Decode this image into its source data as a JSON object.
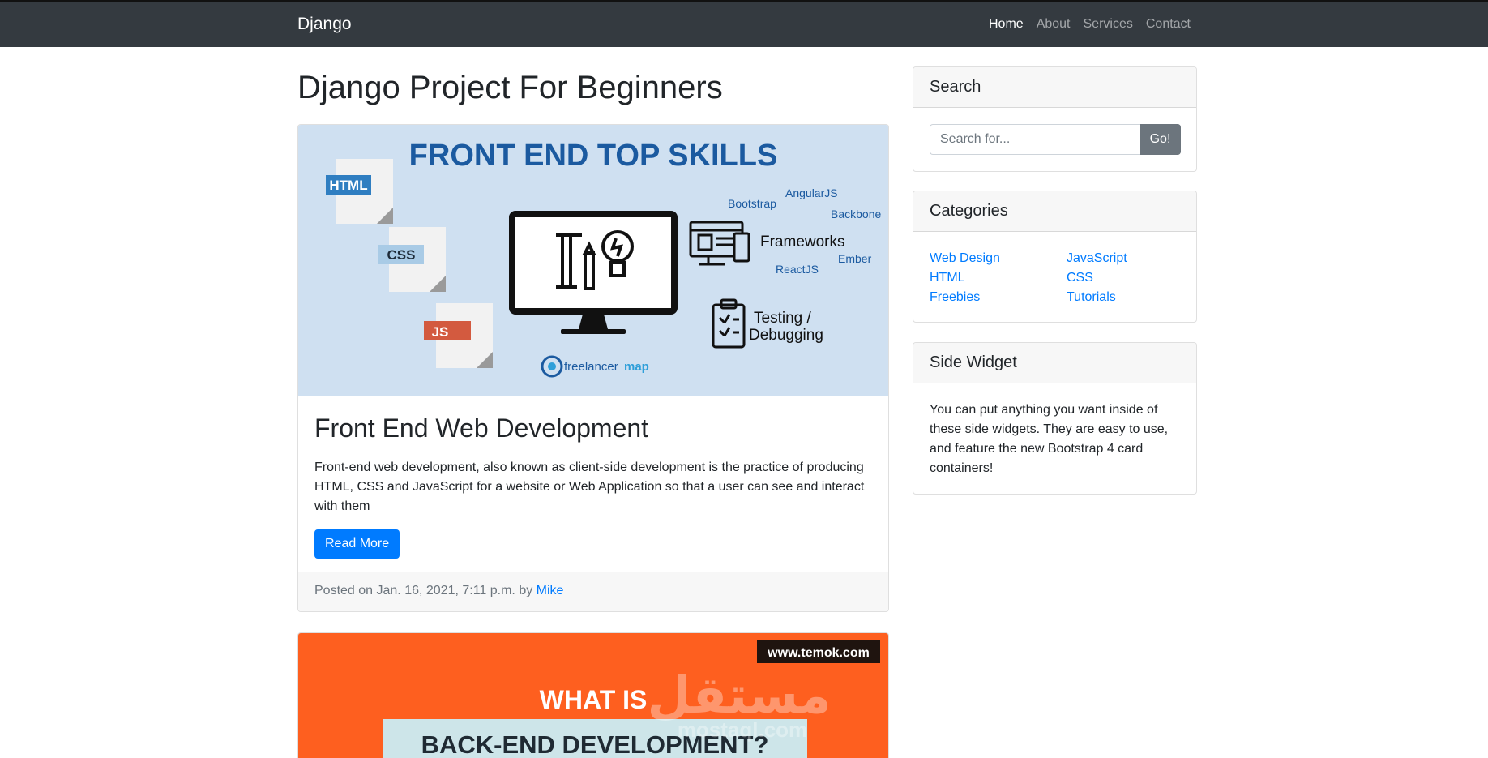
{
  "navbar": {
    "brand": "Django",
    "links": [
      "Home",
      "About",
      "Services",
      "Contact"
    ],
    "active_index": 0
  },
  "page_title": "Django Project For Beginners",
  "posts": [
    {
      "image": {
        "headline": "FRONT END TOP SKILLS",
        "tags": [
          "HTML",
          "CSS",
          "JS"
        ],
        "frameworks_label": "Frameworks",
        "frameworks": [
          "Bootstrap",
          "AngularJS",
          "Backbone",
          "Ember",
          "ReactJS"
        ],
        "testing_label_1": "Testing /",
        "testing_label_2": "Debugging",
        "logo_text_1": "freelancer",
        "logo_text_2": "map",
        "colors": {
          "background": "#cfe0f1",
          "headline": "#1b5aa0"
        }
      },
      "title": "Front End Web Development",
      "text": "Front-end web development, also known as client-side development is the practice of producing HTML, CSS and JavaScript for a website or Web Application so that a user can see and interact with them",
      "button": "Read More",
      "footer_prefix": "Posted on Jan. 16, 2021, 7:11 p.m. by",
      "author": "Mike"
    },
    {
      "image": {
        "badge": "www.temok.com",
        "line1": "WHAT IS",
        "line2": "BACK-END DEVELOPMENT?",
        "colors": {
          "background": "#fe5f1f"
        }
      }
    }
  ],
  "watermark": {
    "arabic": "مستقل",
    "latin": "mostaql.com"
  },
  "sidebar": {
    "search": {
      "title": "Search",
      "placeholder": "Search for...",
      "button": "Go!"
    },
    "categories": {
      "title": "Categories",
      "col1": [
        "Web Design",
        "HTML",
        "Freebies"
      ],
      "col2": [
        "JavaScript",
        "CSS",
        "Tutorials"
      ]
    },
    "side_widget": {
      "title": "Side Widget",
      "text": "You can put anything you want inside of these side widgets. They are easy to use, and feature the new Bootstrap 4 card containers!"
    }
  },
  "colors": {
    "navbar": "#343a40",
    "primary": "#007bff",
    "secondary": "#6c757d"
  }
}
